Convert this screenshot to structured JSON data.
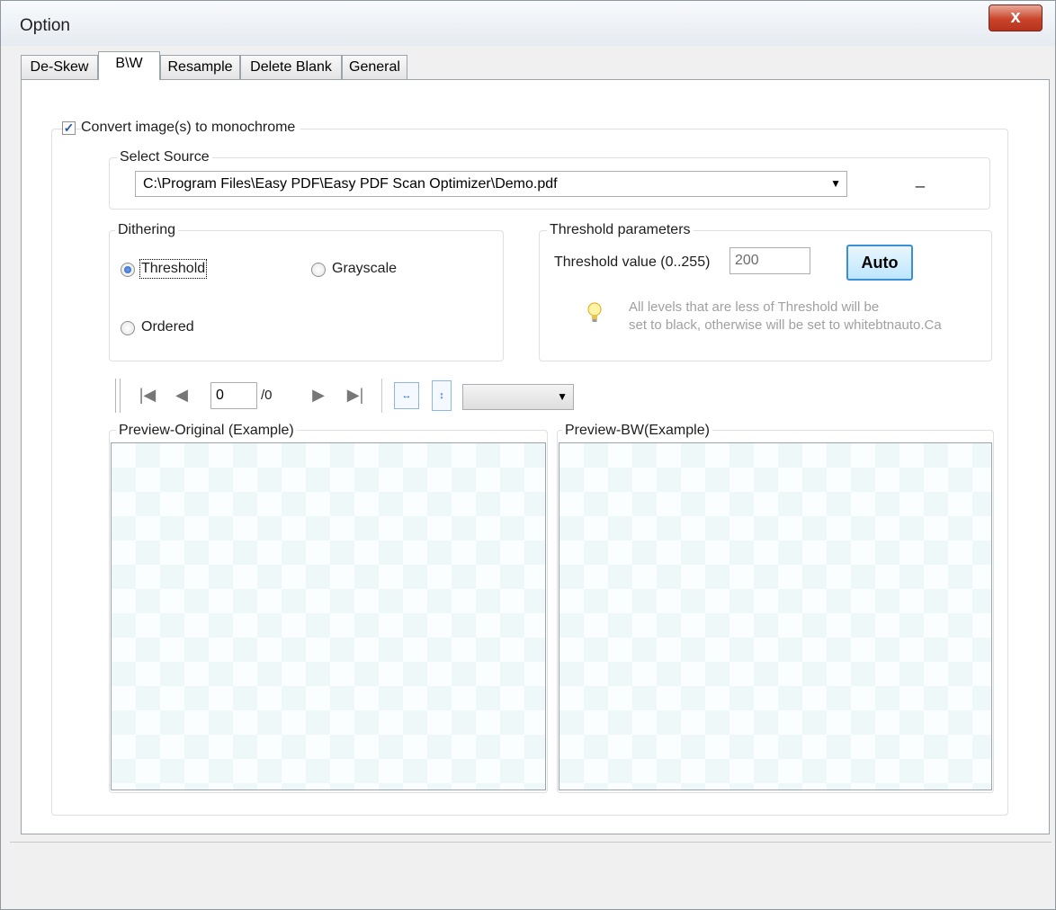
{
  "window": {
    "title": "Option",
    "close_glyph": "x"
  },
  "tabs": [
    {
      "label": "De-Skew",
      "active": false
    },
    {
      "label": "B\\W",
      "active": true
    },
    {
      "label": "Resample",
      "active": false
    },
    {
      "label": "Delete Blank",
      "active": false
    },
    {
      "label": "General",
      "active": false
    }
  ],
  "convert": {
    "label": "Convert image(s) to monochrome",
    "checked": true
  },
  "source": {
    "legend": "Select Source",
    "path": "C:\\Program Files\\Easy PDF\\Easy PDF Scan Optimizer\\Demo.pdf",
    "minimize_glyph": "_"
  },
  "dithering": {
    "legend": "Dithering",
    "options": [
      {
        "label": "Threshold",
        "selected": true
      },
      {
        "label": "Grayscale",
        "selected": false
      },
      {
        "label": "Ordered",
        "selected": false
      }
    ]
  },
  "threshold": {
    "legend": "Threshold parameters",
    "value_label": "Threshold value (0..255)",
    "value": "200",
    "auto_label": "Auto",
    "hint_line1": "All levels that are less of Threshold will be",
    "hint_line2": "set to black, otherwise will be set to whitebtnauto.Ca"
  },
  "navigation": {
    "page_value": "0",
    "page_total": "/0",
    "zoom_value": ""
  },
  "preview": {
    "original_legend": "Preview-Original (Example)",
    "bw_legend": "Preview-BW(Example)"
  },
  "icons": {
    "first": "first-page-icon",
    "prev": "previous-page-icon",
    "next": "next-page-icon",
    "last": "last-page-icon",
    "fit_width": "fit-width-icon",
    "fit_height": "fit-height-icon",
    "hint": "lightbulb-icon"
  }
}
